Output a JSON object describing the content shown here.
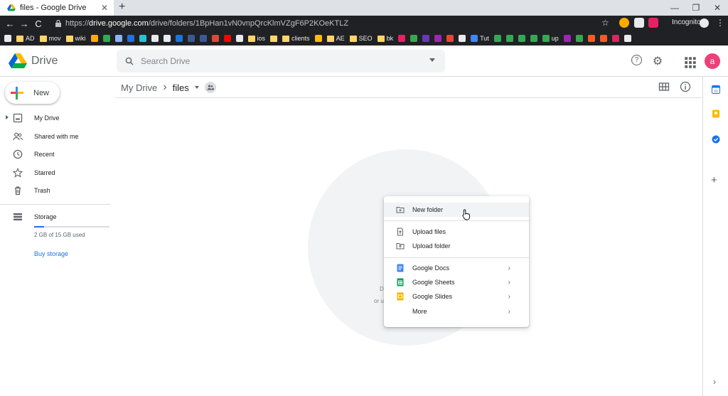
{
  "browser": {
    "tab_title": "files - Google Drive",
    "tab_close": "✕",
    "new_tab": "+",
    "window_controls": [
      "—",
      "❐",
      "✕"
    ],
    "nav": [
      "←",
      "→",
      "C"
    ],
    "url_prefix": "https://",
    "url_host": "drive.google.com",
    "url_path": "/drive/folders/1BpHan1vN0vnpQrcKlmVZgF6P2KOeKTLZ",
    "star": "☆",
    "incognito_label": "Incognito",
    "menu_dots": "⋮"
  },
  "bookmarks": [
    {
      "label": "",
      "kind": "icon",
      "color": "#e8eaed"
    },
    {
      "label": "AD",
      "kind": "folder"
    },
    {
      "label": "mov",
      "kind": "folder"
    },
    {
      "label": "wiki",
      "kind": "folder"
    },
    {
      "label": "",
      "kind": "icon",
      "color": "#f9ab00"
    },
    {
      "label": "",
      "kind": "icon",
      "color": "#34a853"
    },
    {
      "label": "",
      "kind": "icon",
      "color": "#8ab4f8"
    },
    {
      "label": "",
      "kind": "icon",
      "color": "#1a73e8"
    },
    {
      "label": "",
      "kind": "icon",
      "color": "#24c1e0"
    },
    {
      "label": "",
      "kind": "icon",
      "color": "#e8eaed"
    },
    {
      "label": "",
      "kind": "icon",
      "color": "#e8eaed"
    },
    {
      "label": "",
      "kind": "icon",
      "color": "#1a73e8"
    },
    {
      "label": "",
      "kind": "icon",
      "color": "#3b5998"
    },
    {
      "label": "",
      "kind": "icon",
      "color": "#3b5998"
    },
    {
      "label": "",
      "kind": "icon",
      "color": "#ea4335"
    },
    {
      "label": "",
      "kind": "icon",
      "color": "#ff0000"
    },
    {
      "label": "",
      "kind": "icon",
      "color": "#e8eaed"
    },
    {
      "label": "ios",
      "kind": "folder"
    },
    {
      "label": "",
      "kind": "folder"
    },
    {
      "label": "clients",
      "kind": "folder"
    },
    {
      "label": "",
      "kind": "icon",
      "color": "#fbbc04"
    },
    {
      "label": "AE",
      "kind": "folder"
    },
    {
      "label": "SEO",
      "kind": "folder"
    },
    {
      "label": "bk",
      "kind": "folder"
    },
    {
      "label": "",
      "kind": "icon",
      "color": "#e91e63"
    },
    {
      "label": "",
      "kind": "icon",
      "color": "#34a853"
    },
    {
      "label": "",
      "kind": "icon",
      "color": "#673ab7"
    },
    {
      "label": "",
      "kind": "icon",
      "color": "#9c27b0"
    },
    {
      "label": "",
      "kind": "icon",
      "color": "#ea4335"
    },
    {
      "label": "",
      "kind": "icon",
      "color": "#e8eaed"
    },
    {
      "label": "Tut",
      "kind": "icon",
      "color": "#4285f4"
    },
    {
      "label": "",
      "kind": "icon",
      "color": "#34a853"
    },
    {
      "label": "",
      "kind": "icon",
      "color": "#34a853"
    },
    {
      "label": "",
      "kind": "icon",
      "color": "#34a853"
    },
    {
      "label": "",
      "kind": "icon",
      "color": "#34a853"
    },
    {
      "label": "up",
      "kind": "icon",
      "color": "#34a853"
    },
    {
      "label": "",
      "kind": "icon",
      "color": "#9c27b0"
    },
    {
      "label": "",
      "kind": "icon",
      "color": "#34a853"
    },
    {
      "label": "",
      "kind": "icon",
      "color": "#ff5722"
    },
    {
      "label": "",
      "kind": "icon",
      "color": "#ff5722"
    },
    {
      "label": "",
      "kind": "icon",
      "color": "#e91e63"
    },
    {
      "label": "",
      "kind": "icon",
      "color": "#e8eaed"
    }
  ],
  "drive": {
    "app_name": "Drive",
    "search_placeholder": "Search Drive",
    "new_button": "New",
    "avatar_letter": "a",
    "help_icon": "?",
    "settings_icon": "⚙",
    "apps_icon": "⋮⋮⋮"
  },
  "sidebar": {
    "items": [
      {
        "label": "My Drive",
        "icon": "my-drive-icon",
        "glyph": "▣"
      },
      {
        "label": "Shared with me",
        "icon": "shared-icon",
        "glyph": "👥"
      },
      {
        "label": "Recent",
        "icon": "clock-icon",
        "glyph": "◷"
      },
      {
        "label": "Starred",
        "icon": "star-icon",
        "glyph": "☆"
      },
      {
        "label": "Trash",
        "icon": "trash-icon",
        "glyph": "🗑"
      }
    ],
    "storage_label": "Storage",
    "storage_used": "2 GB of 15 GB used",
    "storage_fraction": 0.133,
    "buy_storage": "Buy storage"
  },
  "main": {
    "breadcrumb_root": "My Drive",
    "breadcrumb_sep": "›",
    "breadcrumb_current": "files",
    "empty_hint_a": "D",
    "empty_hint_b": "or u"
  },
  "context_menu": {
    "items": [
      {
        "label": "New folder",
        "icon": "new-folder-icon",
        "glyph": "⊞",
        "has_sub": false,
        "highlight": true
      },
      {
        "label": "Upload files",
        "icon": "upload-file-icon",
        "glyph": "⇧",
        "has_sub": false
      },
      {
        "label": "Upload folder",
        "icon": "upload-folder-icon",
        "glyph": "⇧",
        "has_sub": false
      },
      {
        "label": "Google Docs",
        "icon": "docs-icon",
        "glyph": "≡",
        "color": "#4285f4",
        "has_sub": true
      },
      {
        "label": "Google Sheets",
        "icon": "sheets-icon",
        "glyph": "⊞",
        "color": "#0f9d58",
        "has_sub": true
      },
      {
        "label": "Google Slides",
        "icon": "slides-icon",
        "glyph": "▭",
        "color": "#f4b400",
        "has_sub": true
      },
      {
        "label": "More",
        "icon": "",
        "glyph": "",
        "has_sub": true
      }
    ],
    "sub_arrow": "›"
  },
  "colors": {
    "accent": "#1a73e8",
    "avatar": "#ec407a",
    "calendar": "#1a73e8",
    "keep": "#fbbc04",
    "tasks": "#1a73e8"
  }
}
